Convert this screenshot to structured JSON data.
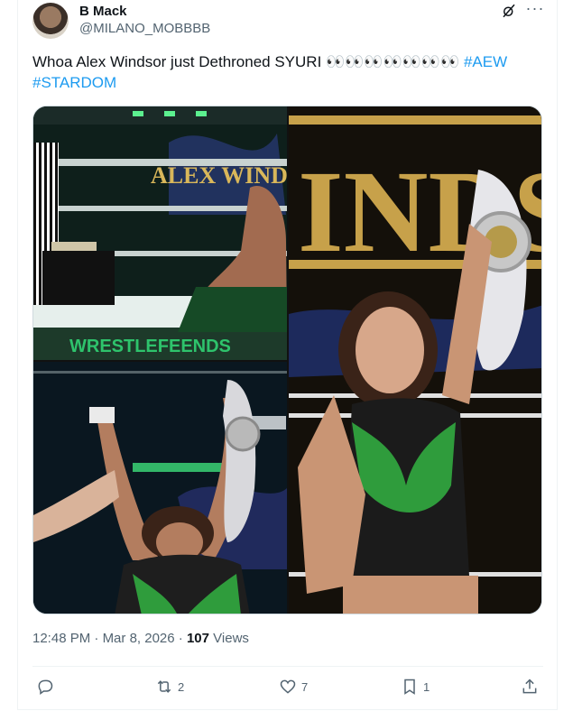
{
  "author": {
    "name": "B Mack",
    "handle": "@MILANO_MOBBBB"
  },
  "post": {
    "text": "Whoa Alex Windsor just Dethroned SYURI",
    "emoji": "👀👀👀👀👀👀👀",
    "hashtags": [
      "#AEW",
      "#STARDOM"
    ]
  },
  "media": {
    "photos": [
      {
        "name": "ringside-photo",
        "visible_text": "ALEX WIND"
      },
      {
        "name": "belt-raised-closeup",
        "visible_text": "INDS"
      },
      {
        "name": "victory-arm-raise"
      }
    ]
  },
  "meta": {
    "time": "12:48 PM",
    "date": "Mar 8, 2026",
    "views_count": "107",
    "views_label": "Views"
  },
  "actions": {
    "replies": "",
    "reposts": "2",
    "likes": "7",
    "bookmarks": "1"
  },
  "colors": {
    "accent": "#1d9bf0",
    "secondary_text": "#536471",
    "border": "#cfd9de"
  },
  "icons": [
    "grok-icon",
    "more-icon",
    "reply-icon",
    "repost-icon",
    "like-icon",
    "bookmark-icon",
    "share-icon"
  ]
}
